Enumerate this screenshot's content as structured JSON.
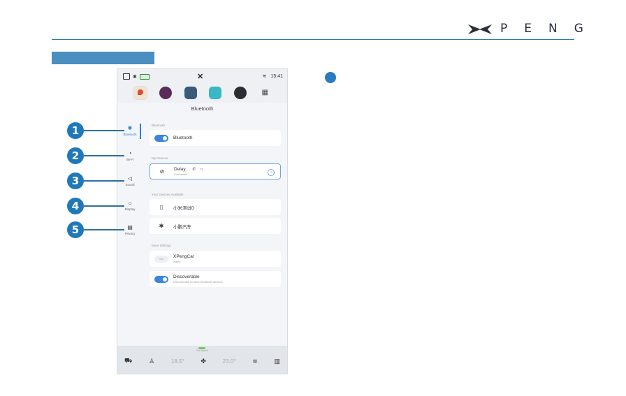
{
  "header": {
    "brand": "PENG",
    "logo_icon": "xpeng-x-logo-icon",
    "accent_color": "#2d7ba2"
  },
  "screen": {
    "status_bar": {
      "time": "15:41"
    },
    "page_title": "Bluetooth",
    "sidebar": [
      {
        "label": "Bluetooth",
        "icon": "bluetooth-icon",
        "active": true
      },
      {
        "label": "Wi-Fi",
        "icon": "wifi-icon",
        "active": false
      },
      {
        "label": "Sound",
        "icon": "speaker-icon",
        "active": false
      },
      {
        "label": "Display",
        "icon": "sun-icon",
        "active": false
      },
      {
        "label": "Privacy",
        "icon": "document-icon",
        "active": false
      }
    ],
    "bluetooth_section": {
      "label": "Bluetooth",
      "toggle_label": "Bluetooth"
    },
    "my_devices": {
      "label": "My Devices",
      "device_name": "Delay",
      "device_status": "Connected"
    },
    "available": {
      "label": "Your Devices Available",
      "devices": [
        "小米测试0",
        "小鹏汽车"
      ]
    },
    "more_settings": {
      "label": "More Settings",
      "name_title": "XPengCar",
      "name_sub": "Name",
      "name_pill": "Info",
      "discoverable_title": "Discoverable",
      "discoverable_sub": "Discoverable to other Bluetooth devices"
    },
    "hvac": {
      "top_label": "Fan Speed",
      "left_temp": "18.5°",
      "right_temp": "23.0°"
    }
  },
  "callouts": [
    "1",
    "2",
    "3",
    "4",
    "5"
  ]
}
